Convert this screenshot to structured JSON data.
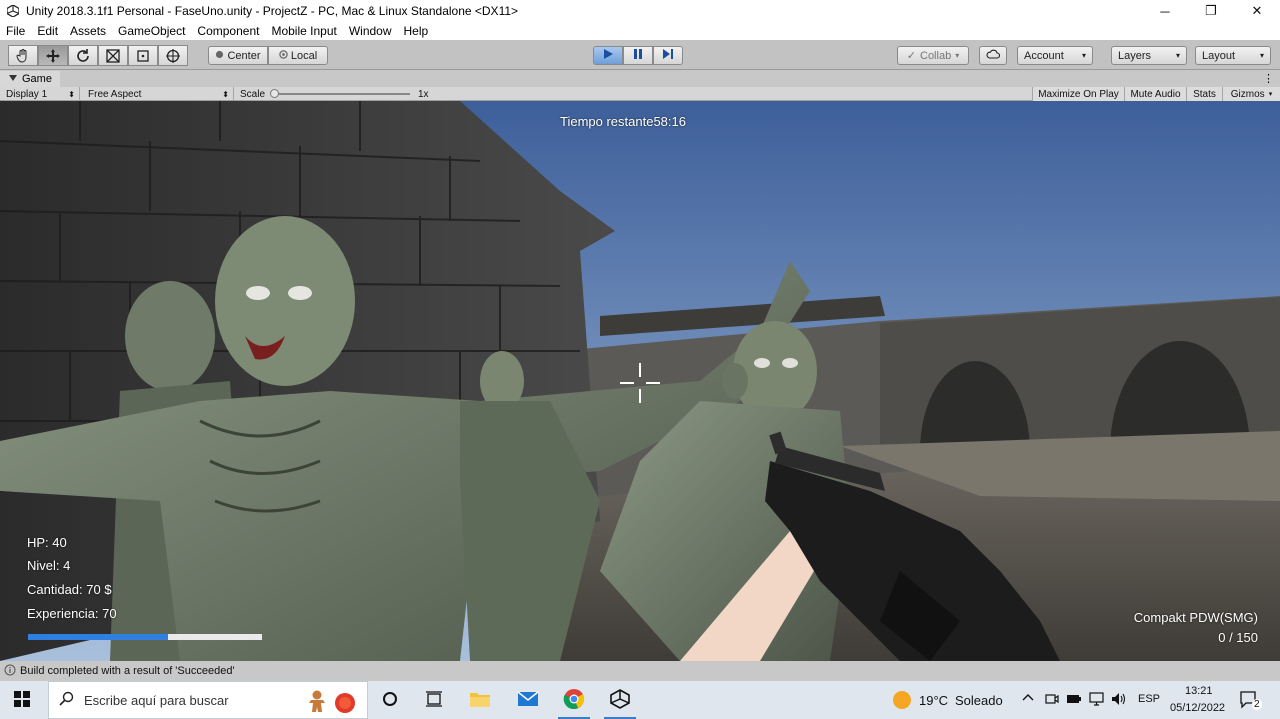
{
  "window": {
    "title": "Unity 2018.3.1f1 Personal - FaseUno.unity - ProjectZ - PC, Mac & Linux Standalone <DX11>",
    "minimize": "─",
    "maximize": "❐",
    "close": "✕"
  },
  "menu": [
    "File",
    "Edit",
    "Assets",
    "GameObject",
    "Component",
    "Mobile Input",
    "Window",
    "Help"
  ],
  "toolbar": {
    "center_label": "Center",
    "local_label": "Local",
    "collab_label": "Collab",
    "account_label": "Account",
    "layers_label": "Layers",
    "layout_label": "Layout"
  },
  "panel": {
    "tab_label": "Game"
  },
  "gamebar": {
    "display": "Display 1",
    "aspect": "Free Aspect",
    "scale_label": "Scale",
    "scale_value": "1x",
    "scale_fraction": 0.0,
    "maximize_on_play": "Maximize On Play",
    "mute_audio": "Mute Audio",
    "stats": "Stats",
    "gizmos": "Gizmos"
  },
  "hud": {
    "timer": "Tiempo restante58:16",
    "hp": "HP: 40",
    "level": "Nivel: 4",
    "money": "Cantidad: 70 $",
    "experience": "Experiencia: 70",
    "xp_fraction": 0.6,
    "weapon_name": "Compakt PDW(SMG)",
    "ammo": "0 / 150"
  },
  "status": {
    "message": "Build completed with a result of 'Succeeded'"
  },
  "taskbar": {
    "search_placeholder": "Escribe aquí para buscar",
    "weather_temp": "19°C",
    "weather_desc": "Soleado",
    "language": "ESP",
    "time": "13:21",
    "date": "05/12/2022",
    "notification_count": "2"
  },
  "colors": {
    "play_active": "#7aa7e0",
    "xp_bar": "#2f7fe0",
    "sky_top": "#3d5f9a",
    "sky_bottom": "#9fb8d8"
  }
}
